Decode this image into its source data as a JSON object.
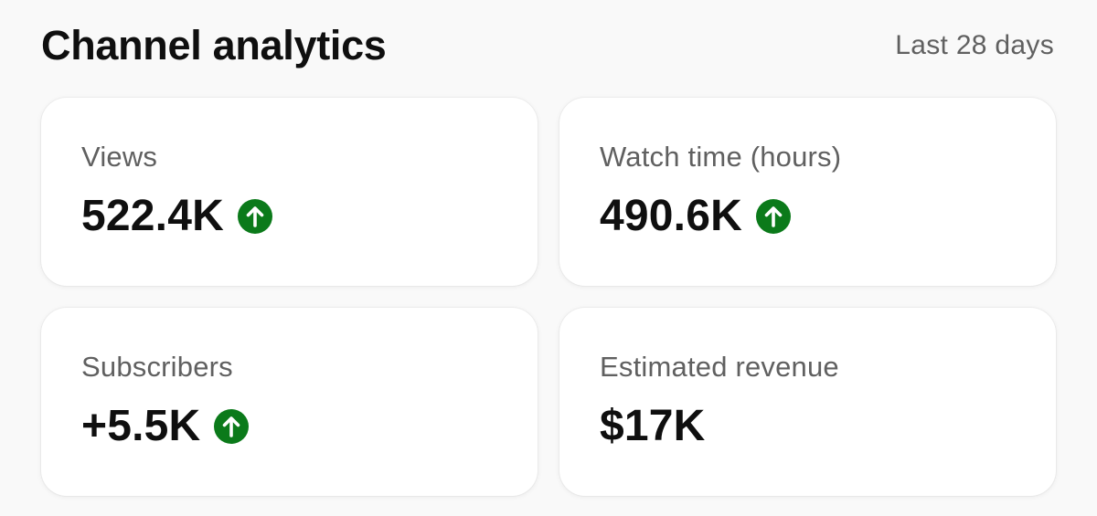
{
  "header": {
    "title": "Channel analytics",
    "date_range": "Last 28 days"
  },
  "cards": [
    {
      "label": "Views",
      "value": "522.4K",
      "trend": "up"
    },
    {
      "label": "Watch time (hours)",
      "value": "490.6K",
      "trend": "up"
    },
    {
      "label": "Subscribers",
      "value": "+5.5K",
      "trend": "up"
    },
    {
      "label": "Estimated revenue",
      "value": "$17K",
      "trend": "none"
    }
  ],
  "colors": {
    "trend_up": "#0b7a1a",
    "title_text": "#0f0f0f",
    "secondary_text": "#606060",
    "card_background": "#ffffff",
    "page_background": "#f9f9f9"
  },
  "icons": {
    "trend_up": "arrow-up-circle-icon"
  }
}
